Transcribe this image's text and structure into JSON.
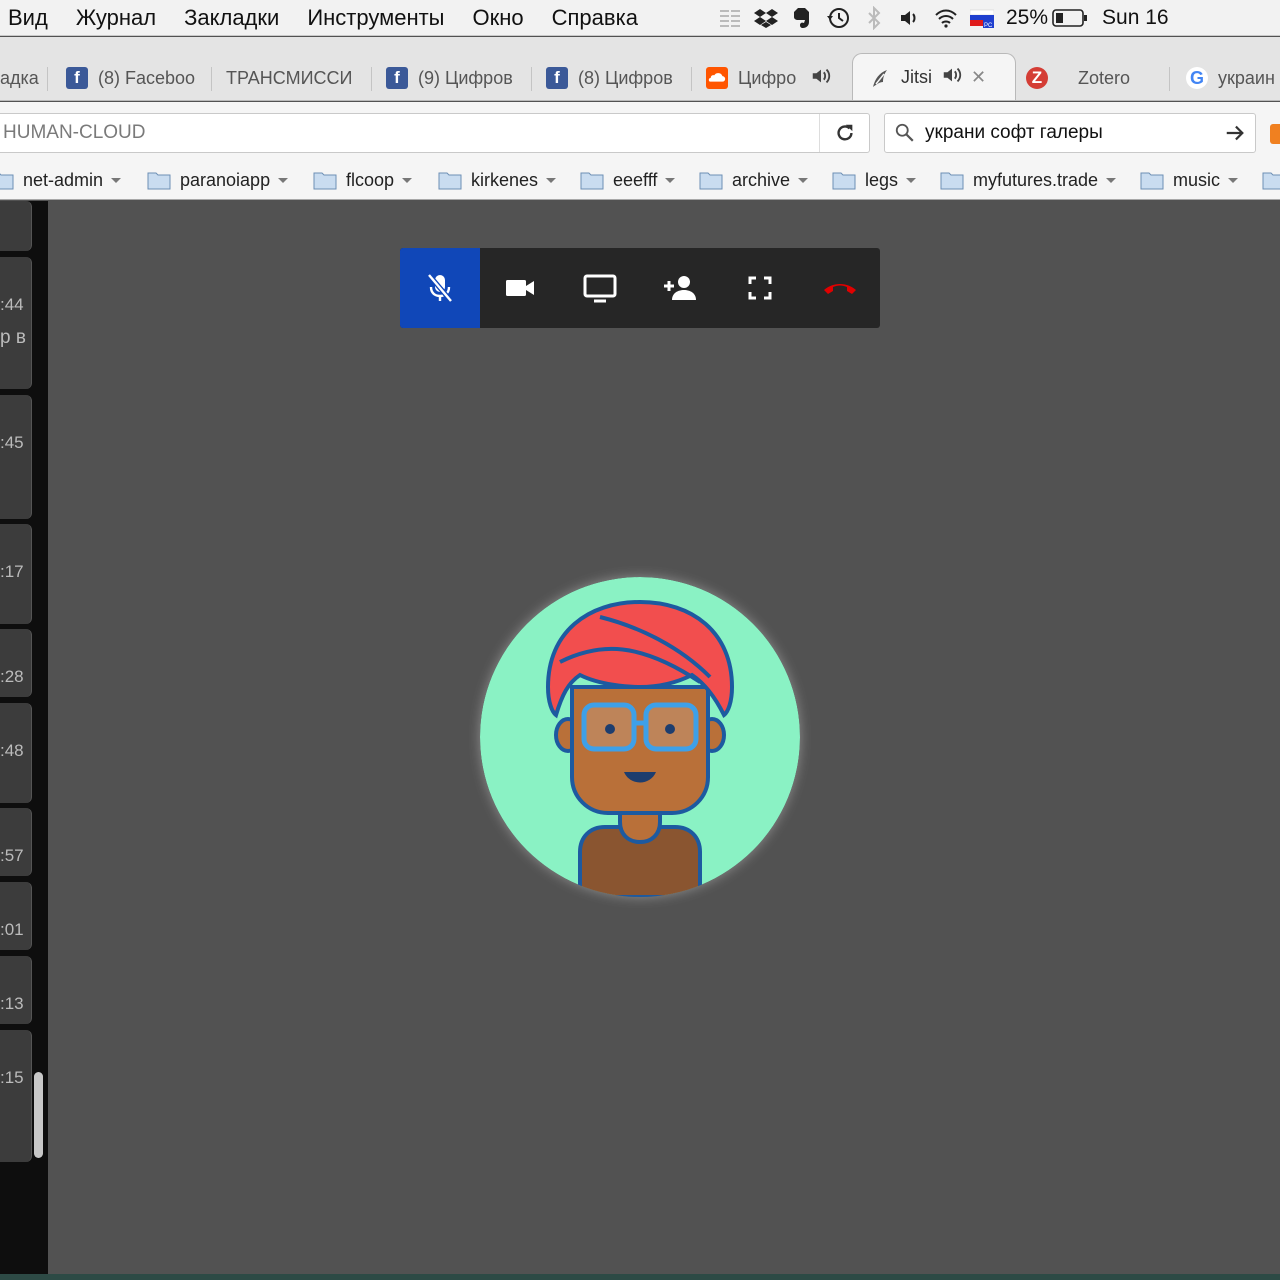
{
  "menubar": {
    "items": [
      "Вид",
      "Журнал",
      "Закладки",
      "Инструменты",
      "Окно",
      "Справка"
    ],
    "status_icons": [
      "columns-icon",
      "dropbox-icon",
      "evernote-icon",
      "time-machine-icon",
      "bluetooth-icon",
      "volume-icon",
      "wifi-icon",
      "flag-ru-icon"
    ],
    "battery": "25%",
    "clock": "Sun 16"
  },
  "tabs": [
    {
      "title": "адка",
      "favicon": "none"
    },
    {
      "title": "(8) Faceboo",
      "favicon": "facebook-icon"
    },
    {
      "title": "ТРАНСМИССИ",
      "favicon": "none"
    },
    {
      "title": "(9) Цифров",
      "favicon": "facebook-icon"
    },
    {
      "title": "(8) Цифров",
      "favicon": "facebook-icon"
    },
    {
      "title": "Цифро",
      "favicon": "soundcloud-icon",
      "audio": true
    },
    {
      "title": "Jitsi",
      "favicon": "jitsi-icon",
      "audio": true,
      "active": true
    },
    {
      "title": "Zotero",
      "favicon": "zotero-icon"
    },
    {
      "title": "украин",
      "favicon": "google-icon"
    }
  ],
  "address": {
    "value": "HUMAN-CLOUD"
  },
  "search": {
    "value": "украни софт галеры"
  },
  "bookmarks": [
    "net-admin",
    "paranoiapp",
    "flcoop",
    "kirkenes",
    "eeefff",
    "archive",
    "legs",
    "myfutures.trade",
    "music"
  ],
  "chat": {
    "times": [
      ":44",
      ":45",
      ":17",
      ":28",
      ":48",
      ":57",
      ":01",
      ":13",
      ":15"
    ],
    "snippet": "р в"
  },
  "call_toolbar": {
    "buttons": [
      "microphone-muted-icon",
      "camera-icon",
      "screen-share-icon",
      "add-person-icon",
      "fullscreen-icon",
      "hangup-icon"
    ],
    "active_button": "microphone-muted-icon",
    "colors": {
      "active": "#1047b8",
      "hangup": "#e00000"
    }
  },
  "avatar": {
    "background": "#8af2c4",
    "turban": "#f24e4e",
    "skin": "#b97039"
  }
}
